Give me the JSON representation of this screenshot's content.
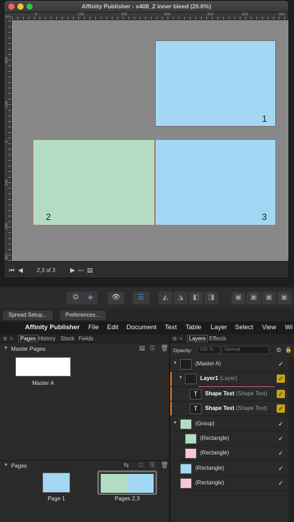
{
  "window": {
    "title": "Affinity Publisher - v408_2 inner bleed (20.6%)",
    "ruler_unit": "mm",
    "ruler_top_labels": [
      "0",
      "100",
      "200",
      "300",
      "400",
      "500",
      "600"
    ],
    "ruler_left_labels": [
      "-200",
      "-100",
      "0",
      "100",
      "200",
      "300"
    ],
    "page_numbers": [
      "1",
      "2",
      "3"
    ],
    "status_pages": "2,3 of 3"
  },
  "colors": {
    "blue_page": "#a3d8f4",
    "green_page": "#b4dcc3",
    "canvas": "#888888",
    "highlight": "#c5a21a",
    "accent_orange": "#e67e22"
  },
  "context": {
    "spread_setup": "Spread Setup...",
    "preferences": "Preferences..."
  },
  "menubar": {
    "apple": "",
    "app": "Affinity Publisher",
    "items": [
      "File",
      "Edit",
      "Document",
      "Text",
      "Table",
      "Layer",
      "Select",
      "View",
      "Wi"
    ]
  },
  "left_panel": {
    "tabs": [
      "Pages",
      "History",
      "Stock",
      "Fields"
    ],
    "master_pages_heading": "Master Pages",
    "master_a_label": "Master A",
    "pages_heading": "Pages",
    "page1_label": "Page 1",
    "pages23_label": "Pages 2,3"
  },
  "right_panel": {
    "tabs": [
      "Layers",
      "Effects"
    ],
    "opacity_label": "Opacity:",
    "opacity_value": "100 %",
    "blend_mode": "Normal",
    "layers": [
      {
        "name": "(Master A)",
        "type": ""
      },
      {
        "name": "Layer1",
        "type": "(Layer)"
      },
      {
        "name": "Shape Text",
        "type": "(Shape Text)"
      },
      {
        "name": "Shape Text",
        "type": "(Shape Text)"
      },
      {
        "name": "(Group)",
        "type": ""
      },
      {
        "name": "(Rectangle)",
        "type": ""
      },
      {
        "name": "(Rectangle)",
        "type": ""
      },
      {
        "name": "(Rectangle)",
        "type": ""
      },
      {
        "name": "(Rectangle)",
        "type": ""
      }
    ],
    "check": "✓"
  }
}
